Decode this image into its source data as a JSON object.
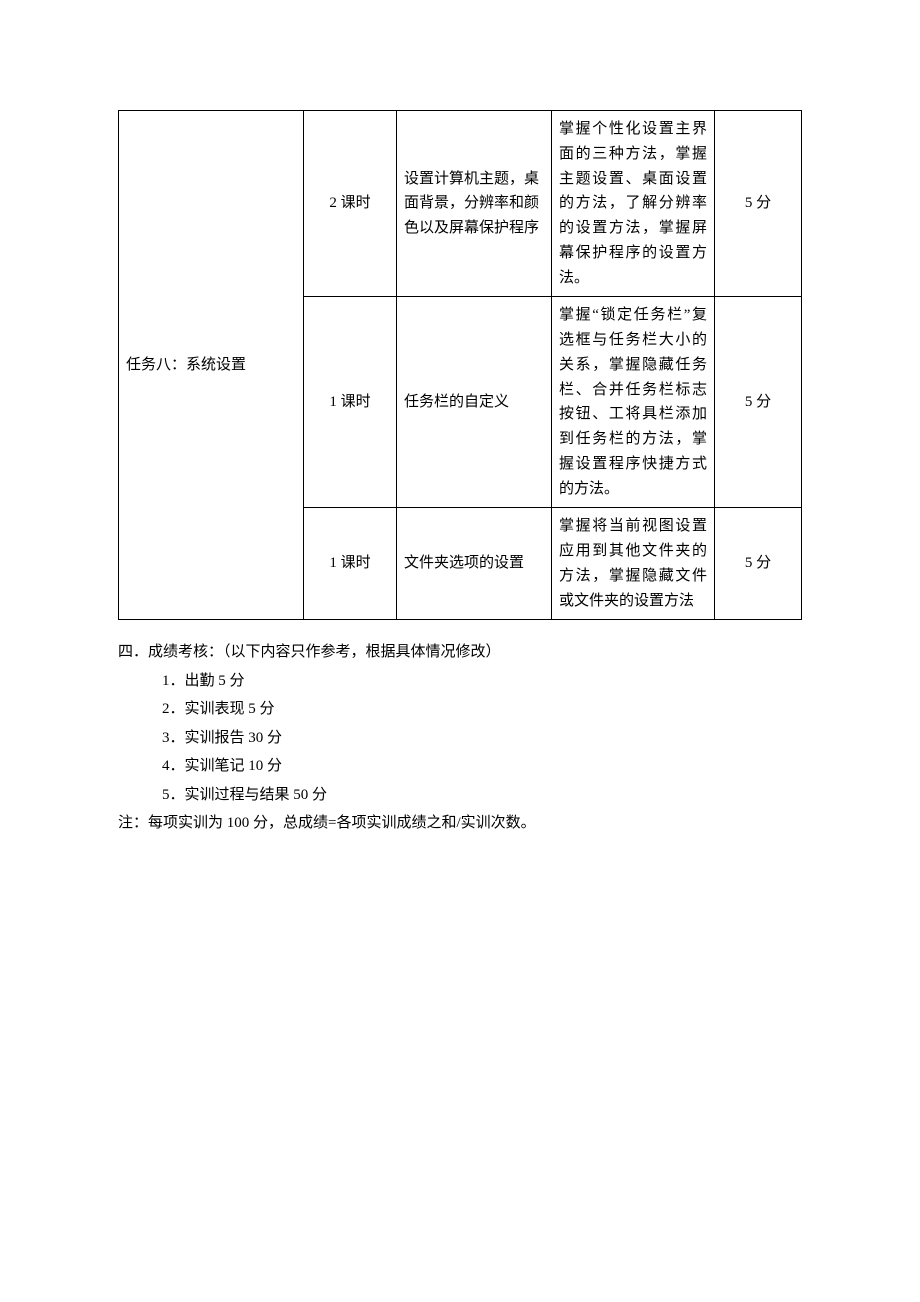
{
  "table": {
    "task_label": "任务八：系统设置",
    "rows": [
      {
        "time": "2 课时",
        "content": "设置计算机主题，桌面背景，分辨率和颜色以及屏幕保护程序",
        "objective": "掌握个性化设置主界面的三种方法，掌握主题设置、桌面设置的方法，了解分辨率的设置方法，掌握屏幕保护程序的设置方法。",
        "score": "5 分"
      },
      {
        "time": "1 课时",
        "content": "任务栏的自定义",
        "objective": "掌握“锁定任务栏”复选框与任务栏大小的关系，掌握隐藏任务栏、合并任务栏标志按钮、工将具栏添加到任务栏的方法，掌握设置程序快捷方式的方法。",
        "score": "5 分"
      },
      {
        "time": "1 课时",
        "content": "文件夹选项的设置",
        "objective": "掌握将当前视图设置应用到其他文件夹的方法，掌握隐藏文件或文件夹的设置方法",
        "score": "5 分"
      }
    ]
  },
  "section4": {
    "heading": "四．成绩考核：（以下内容只作参考，根据具体情况修改）",
    "items": [
      "1．出勤 5 分",
      "2．实训表现 5 分",
      "3．实训报告 30 分",
      "4．实训笔记 10 分",
      "5．实训过程与结果 50 分"
    ],
    "note": "注：每项实训为 100 分，总成绩=各项实训成绩之和/实训次数。"
  }
}
